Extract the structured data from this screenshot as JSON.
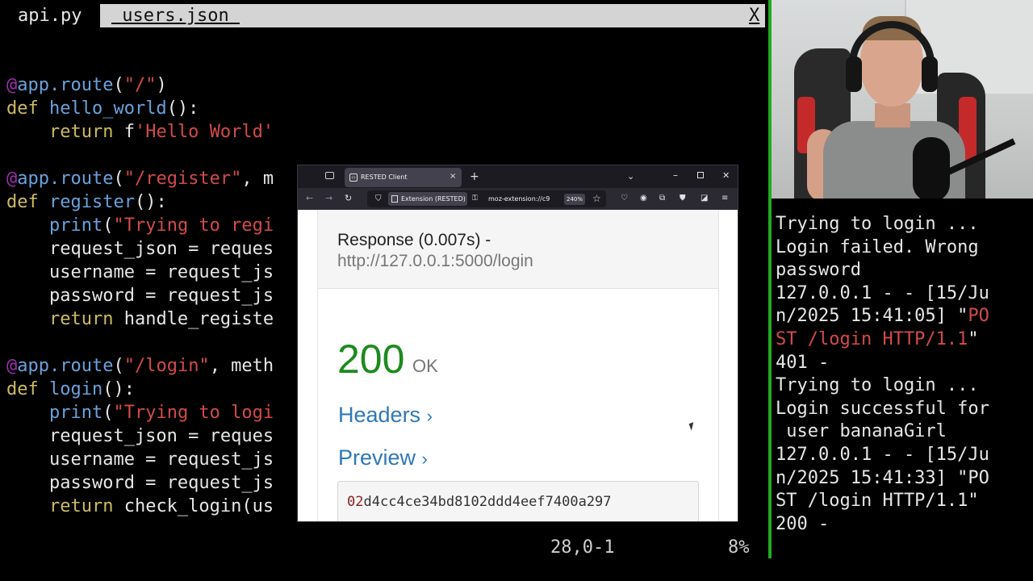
{
  "editor": {
    "tabs": [
      {
        "label": "api.py"
      },
      {
        "label": " users.json "
      }
    ],
    "close_label": "X",
    "code": [
      {
        "parts": [
          {
            "t": "@",
            "c": "dec"
          },
          {
            "t": "app.route",
            "c": "fn"
          },
          {
            "t": "(",
            "c": "txt"
          },
          {
            "t": "\"/\"",
            "c": "str"
          },
          {
            "t": ")",
            "c": "txt"
          }
        ]
      },
      {
        "parts": [
          {
            "t": "def ",
            "c": "kw"
          },
          {
            "t": "hello_world",
            "c": "fn"
          },
          {
            "t": "():",
            "c": "txt"
          }
        ]
      },
      {
        "parts": [
          {
            "t": "    return ",
            "c": "kw"
          },
          {
            "t": "f",
            "c": "txt"
          },
          {
            "t": "'Hello World'",
            "c": "str"
          }
        ]
      },
      {
        "parts": []
      },
      {
        "parts": [
          {
            "t": "@",
            "c": "dec"
          },
          {
            "t": "app.route",
            "c": "fn"
          },
          {
            "t": "(",
            "c": "txt"
          },
          {
            "t": "\"/register\"",
            "c": "str"
          },
          {
            "t": ", m",
            "c": "txt"
          }
        ]
      },
      {
        "parts": [
          {
            "t": "def ",
            "c": "kw"
          },
          {
            "t": "register",
            "c": "fn"
          },
          {
            "t": "():",
            "c": "txt"
          }
        ]
      },
      {
        "parts": [
          {
            "t": "    print",
            "c": "fn"
          },
          {
            "t": "(",
            "c": "txt"
          },
          {
            "t": "\"Trying to regi",
            "c": "str"
          }
        ]
      },
      {
        "parts": [
          {
            "t": "    request_json = reques",
            "c": "txt"
          }
        ]
      },
      {
        "parts": [
          {
            "t": "    username = request_js",
            "c": "txt"
          }
        ]
      },
      {
        "parts": [
          {
            "t": "    password = request_js",
            "c": "txt"
          }
        ]
      },
      {
        "parts": [
          {
            "t": "    return ",
            "c": "kw"
          },
          {
            "t": "handle_registe",
            "c": "txt"
          }
        ]
      },
      {
        "parts": []
      },
      {
        "parts": [
          {
            "t": "@",
            "c": "dec"
          },
          {
            "t": "app.route",
            "c": "fn"
          },
          {
            "t": "(",
            "c": "txt"
          },
          {
            "t": "\"/login\"",
            "c": "str"
          },
          {
            "t": ", meth",
            "c": "txt"
          }
        ]
      },
      {
        "parts": [
          {
            "t": "def ",
            "c": "kw"
          },
          {
            "t": "login",
            "c": "fn"
          },
          {
            "t": "():",
            "c": "txt"
          }
        ]
      },
      {
        "parts": [
          {
            "t": "    print",
            "c": "fn"
          },
          {
            "t": "(",
            "c": "txt"
          },
          {
            "t": "\"Trying to logi",
            "c": "str"
          }
        ]
      },
      {
        "parts": [
          {
            "t": "    request_json = reques",
            "c": "txt"
          }
        ]
      },
      {
        "parts": [
          {
            "t": "    username = request_js",
            "c": "txt"
          }
        ]
      },
      {
        "parts": [
          {
            "t": "    password = request_js",
            "c": "txt"
          }
        ]
      },
      {
        "parts": [
          {
            "t": "    return ",
            "c": "kw"
          },
          {
            "t": "check_login(us",
            "c": "txt"
          }
        ]
      }
    ],
    "status": {
      "position": "28,0-1",
      "percent": "8%"
    }
  },
  "terminal": {
    "lines": [
      {
        "parts": [
          {
            "t": "Trying to login ..."
          }
        ]
      },
      {
        "parts": [
          {
            "t": "Login failed. Wrong"
          }
        ]
      },
      {
        "parts": [
          {
            "t": "password"
          }
        ]
      },
      {
        "parts": [
          {
            "t": "127.0.0.1 - - [15/Ju"
          }
        ]
      },
      {
        "parts": [
          {
            "t": "n/2025 15:41:05] \""
          },
          {
            "t": "PO",
            "red": true
          }
        ]
      },
      {
        "parts": [
          {
            "t": "ST /login HTTP/1.1",
            "red": true
          },
          {
            "t": "\""
          }
        ]
      },
      {
        "parts": [
          {
            "t": "401 -"
          }
        ]
      },
      {
        "parts": [
          {
            "t": "Trying to login ..."
          }
        ]
      },
      {
        "parts": [
          {
            "t": "Login successful for"
          }
        ]
      },
      {
        "parts": [
          {
            "t": " user bananaGirl"
          }
        ]
      },
      {
        "parts": [
          {
            "t": "127.0.0.1 - - [15/Ju"
          }
        ]
      },
      {
        "parts": [
          {
            "t": "n/2025 15:41:33] \"PO"
          }
        ]
      },
      {
        "parts": [
          {
            "t": "ST /login HTTP/1.1\""
          }
        ]
      },
      {
        "parts": [
          {
            "t": "200 -"
          }
        ]
      }
    ]
  },
  "browser": {
    "tab_title": "RESTED Client",
    "tab_close": "×",
    "new_tab": "+",
    "tab_list": "⌄",
    "win_min": "–",
    "win_close": "✕",
    "nav": {
      "back": "←",
      "forward": "→",
      "reload": "↻"
    },
    "url": {
      "extension_label": "Extension (RESTED)",
      "text": "moz-extension://c9",
      "zoom": "240%"
    },
    "response": {
      "title": "Response (0.007s) -",
      "url": "http://127.0.0.1:5000/login",
      "status_code": "200",
      "status_text": "OK",
      "headers_label": "Headers",
      "preview_label": "Preview",
      "chevron": "›",
      "preview_number": "02",
      "preview_rest": "d4cc4ce34bd8102ddd4eef7400a297"
    }
  },
  "colors": {
    "divider": "#22aa22",
    "status_ok": "#1e8a1e",
    "link": "#2f78b8",
    "string": "#d34a4a",
    "keyword": "#cdbb63",
    "function": "#6aa1dc",
    "decorator": "#9d2fb0"
  }
}
